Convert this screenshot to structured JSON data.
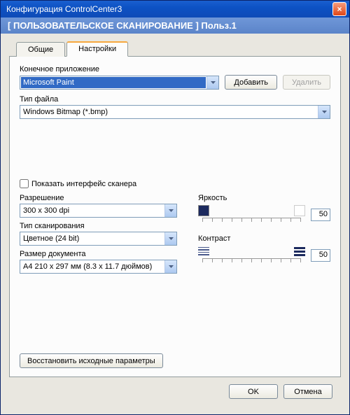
{
  "window": {
    "title": "Конфигурация ControlCenter3",
    "subtitle": "[  ПОЛЬЗОВАТЕЛЬСКОЕ СКАНИРОВАНИЕ  ]   Польз.1",
    "close": "×"
  },
  "tabs": {
    "general": "Общие",
    "settings": "Настройки"
  },
  "app": {
    "label": "Конечное приложение",
    "value": "Microsoft Paint",
    "add": "Добавить",
    "delete": "Удалить"
  },
  "filetype": {
    "label": "Тип файла",
    "value": "Windows Bitmap (*.bmp)"
  },
  "showInterface": {
    "label": "Показать интерфейс сканера"
  },
  "resolution": {
    "label": "Разрешение",
    "value": "300 x 300 dpi"
  },
  "scantype": {
    "label": "Тип сканирования",
    "value": "Цветное (24 bit)"
  },
  "docsize": {
    "label": "Размер документа",
    "value": "A4 210 x 297 мм (8.3 x 11.7 дюймов)"
  },
  "brightness": {
    "label": "Яркость",
    "value": "50",
    "darkColor": "#1c2a5e",
    "lightColor": "#ffffff"
  },
  "contrast": {
    "label": "Контраст",
    "value": "50",
    "lowColor": "#4a5a8c",
    "highColor": "#1c2a5e"
  },
  "restore": "Восстановить исходные параметры",
  "footer": {
    "ok": "OK",
    "cancel": "Отмена"
  }
}
